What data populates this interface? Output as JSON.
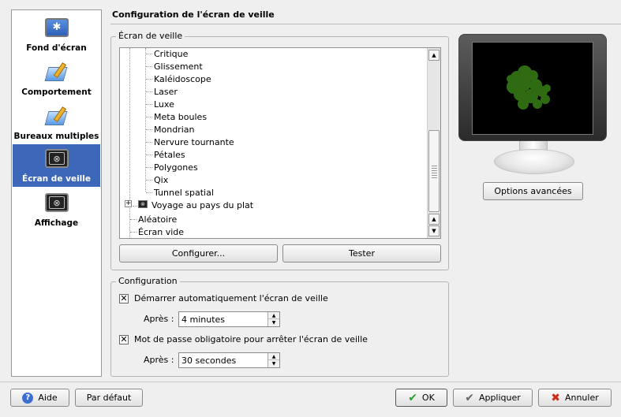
{
  "sidebar": {
    "items": [
      {
        "label": "Fond d'écran",
        "icon": "wallpaper-icon"
      },
      {
        "label": "Comportement",
        "icon": "behavior-icon"
      },
      {
        "label": "Bureaux multiples",
        "icon": "multiple-desktops-icon"
      },
      {
        "label": "Écran de veille",
        "icon": "screensaver-icon",
        "selected": true
      },
      {
        "label": "Affichage",
        "icon": "display-icon"
      }
    ]
  },
  "header": {
    "title": "Configuration de l'écran de veille"
  },
  "screensaver_group": {
    "title": "Écran de veille",
    "list": {
      "children": [
        "Critique",
        "Glissement",
        "Kaléidoscope",
        "Laser",
        "Luxe",
        "Meta boules",
        "Mondrian",
        "Nervure tournante",
        "Pétales",
        "Polygones",
        "Qix",
        "Tunnel spatial"
      ],
      "collapsed_item": "Voyage au pays du plat",
      "top_items": [
        "Aléatoire",
        "Écran vide"
      ]
    },
    "configure_button": "Configurer...",
    "test_button": "Tester"
  },
  "preview": {
    "advanced_button": "Options avancées",
    "preview_color": "#2e6b12"
  },
  "config_group": {
    "title": "Configuration",
    "auto_start_label": "Démarrer automatiquement l'écran de veille",
    "auto_start_checked": true,
    "after_label_1": "Après :",
    "after_value_1": "4 minutes",
    "password_label": "Mot de passe obligatoire pour arrêter l'écran de veille",
    "password_checked": true,
    "after_label_2": "Après :",
    "after_value_2": "30 secondes"
  },
  "footer": {
    "help_label": "Aide",
    "defaults_label": "Par défaut",
    "ok_label": "OK",
    "apply_label": "Appliquer",
    "cancel_label": "Annuler"
  }
}
